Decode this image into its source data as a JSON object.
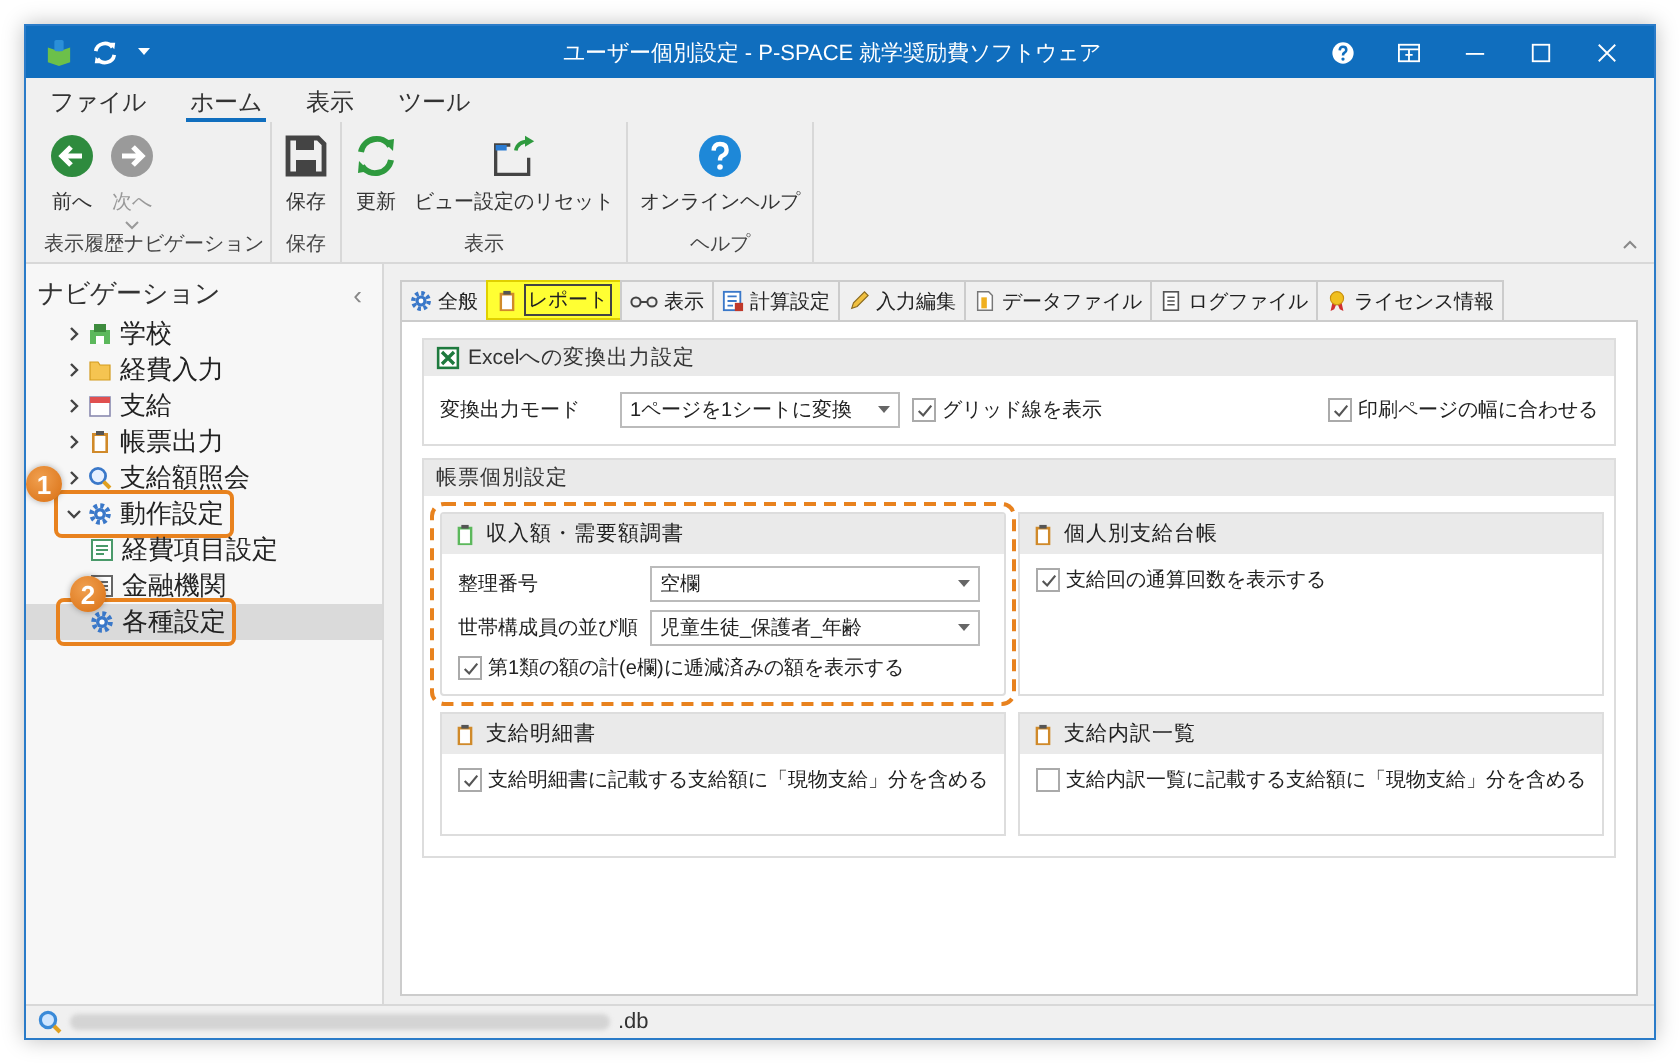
{
  "window": {
    "title": "ユーザー個別設定 - P-SPACE 就学奨励費ソフトウェア"
  },
  "ribbon": {
    "tabs": [
      {
        "label": "ファイル",
        "selected": false
      },
      {
        "label": "ホーム",
        "selected": true
      },
      {
        "label": "表示",
        "selected": false
      },
      {
        "label": "ツール",
        "selected": false
      }
    ],
    "groups": [
      {
        "label": "表示履歴ナビゲーション",
        "buttons": [
          {
            "label": "前へ",
            "kind": "back",
            "disabled": false,
            "dropdown": false
          },
          {
            "label": "次へ",
            "kind": "forward",
            "disabled": true,
            "dropdown": true
          }
        ]
      },
      {
        "label": "保存",
        "buttons": [
          {
            "label": "保存",
            "kind": "save",
            "disabled": false,
            "dropdown": false
          }
        ]
      },
      {
        "label": "表示",
        "buttons": [
          {
            "label": "更新",
            "kind": "refresh",
            "disabled": false,
            "dropdown": false
          },
          {
            "label": "ビュー設定のリセット",
            "kind": "reset",
            "disabled": false,
            "dropdown": false
          }
        ]
      },
      {
        "label": "ヘルプ",
        "buttons": [
          {
            "label": "オンラインヘルプ",
            "kind": "help",
            "disabled": false,
            "dropdown": false
          }
        ]
      }
    ]
  },
  "navigation": {
    "title": "ナビゲーション",
    "collapse": "‹",
    "items": [
      {
        "label": "学校",
        "kind": "school",
        "expanded": false,
        "selected": false
      },
      {
        "label": "経費入力",
        "kind": "folder",
        "expanded": false,
        "selected": false
      },
      {
        "label": "支給",
        "kind": "calendar",
        "expanded": false,
        "selected": false
      },
      {
        "label": "帳票出力",
        "kind": "clipboard",
        "expanded": false,
        "selected": false
      },
      {
        "label": "支給額照会",
        "kind": "search",
        "expanded": false,
        "selected": false
      },
      {
        "label": "動作設定",
        "kind": "gear",
        "expanded": true,
        "selected": false,
        "callout": "1",
        "children": [
          {
            "label": "経費項目設定",
            "kind": "list",
            "selected": false
          },
          {
            "label": "金融機関",
            "kind": "bank",
            "selected": false
          },
          {
            "label": "各種設定",
            "kind": "gear",
            "selected": true,
            "callout": "2"
          }
        ]
      }
    ]
  },
  "settings_tabs": [
    {
      "label": "全般",
      "kind": "gear",
      "selected": false
    },
    {
      "label": "レポート",
      "kind": "clipboard",
      "selected": true
    },
    {
      "label": "表示",
      "kind": "glasses",
      "selected": false
    },
    {
      "label": "計算設定",
      "kind": "calc",
      "selected": false
    },
    {
      "label": "入力編集",
      "kind": "pencil",
      "selected": false
    },
    {
      "label": "データファイル",
      "kind": "doc",
      "selected": false
    },
    {
      "label": "ログファイル",
      "kind": "log",
      "selected": false
    },
    {
      "label": "ライセンス情報",
      "kind": "award",
      "selected": false
    }
  ],
  "excel_section": {
    "title": "Excelへの変換出力設定",
    "mode_label": "変換出力モード",
    "mode_value": "1ページを1シートに変換",
    "checkboxes": [
      {
        "label": "グリッド線を表示",
        "checked": true
      },
      {
        "label": "印刷ページの幅に合わせる",
        "checked": true
      }
    ]
  },
  "report_section": {
    "title": "帳票個別設定",
    "groups": [
      {
        "title": "収入額・需要額調書",
        "highlighted": true,
        "fields": [
          {
            "label": "整理番号",
            "value": "空欄"
          },
          {
            "label": "世帯構成員の並び順",
            "value": "児童生徒_保護者_年齢"
          }
        ],
        "checkboxes": [
          {
            "label": "第1類の額の計(e欄)に逓減済みの額を表示する",
            "checked": true
          }
        ]
      },
      {
        "title": "個人別支給台帳",
        "highlighted": false,
        "checkboxes": [
          {
            "label": "支給回の通算回数を表示する",
            "checked": true
          }
        ]
      },
      {
        "title": "支給明細書",
        "highlighted": false,
        "checkboxes": [
          {
            "label": "支給明細書に記載する支給額に「現物支給」分を含める",
            "checked": true
          }
        ]
      },
      {
        "title": "支給内訳一覧",
        "highlighted": false,
        "checkboxes": [
          {
            "label": "支給内訳一覧に記載する支給額に「現物支給」分を含める",
            "checked": false
          }
        ]
      }
    ]
  },
  "status_bar": {
    "path_end": ".db"
  }
}
